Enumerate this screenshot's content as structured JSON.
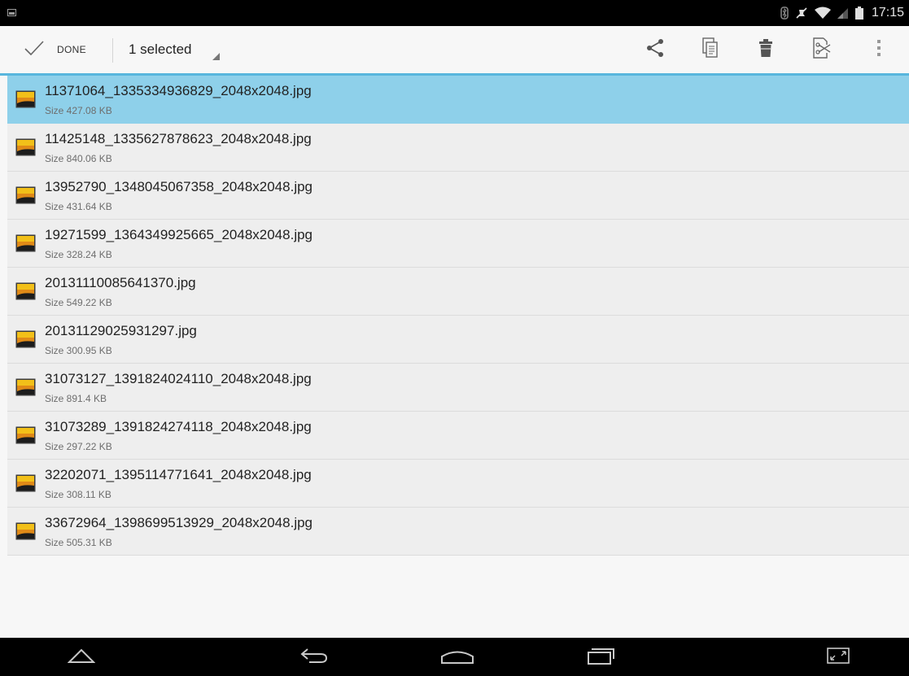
{
  "status_bar": {
    "time": "17:15",
    "icons": [
      "screenshot-icon",
      "bluetooth-icon",
      "mute-icon",
      "wifi-icon",
      "signal-icon",
      "battery-icon"
    ]
  },
  "action_bar": {
    "done_label": "DONE",
    "selection_label": "1 selected",
    "actions": [
      "share-icon",
      "copy-icon",
      "delete-icon",
      "cut-icon",
      "overflow-menu-icon"
    ],
    "accent_color": "#58b6dd"
  },
  "files": [
    {
      "name": "11371064_1335334936829_2048x2048.jpg",
      "size": "Size 427.08 KB",
      "selected": true
    },
    {
      "name": "11425148_1335627878623_2048x2048.jpg",
      "size": "Size 840.06 KB",
      "selected": false
    },
    {
      "name": "13952790_1348045067358_2048x2048.jpg",
      "size": "Size 431.64 KB",
      "selected": false
    },
    {
      "name": "19271599_1364349925665_2048x2048.jpg",
      "size": "Size 328.24 KB",
      "selected": false
    },
    {
      "name": "20131110085641370.jpg",
      "size": "Size 549.22 KB",
      "selected": false
    },
    {
      "name": "20131129025931297.jpg",
      "size": "Size 300.95 KB",
      "selected": false
    },
    {
      "name": "31073127_1391824024110_2048x2048.jpg",
      "size": "Size 891.4 KB",
      "selected": false
    },
    {
      "name": "31073289_1391824274118_2048x2048.jpg",
      "size": "Size 297.22 KB",
      "selected": false
    },
    {
      "name": "32202071_1395114771641_2048x2048.jpg",
      "size": "Size 308.11 KB",
      "selected": false
    },
    {
      "name": "33672964_1398699513929_2048x2048.jpg",
      "size": "Size 505.31 KB",
      "selected": false
    }
  ],
  "nav_bar": {
    "buttons": [
      "back-icon",
      "home-icon",
      "recent-apps-icon",
      "fullscreen-icon"
    ]
  }
}
